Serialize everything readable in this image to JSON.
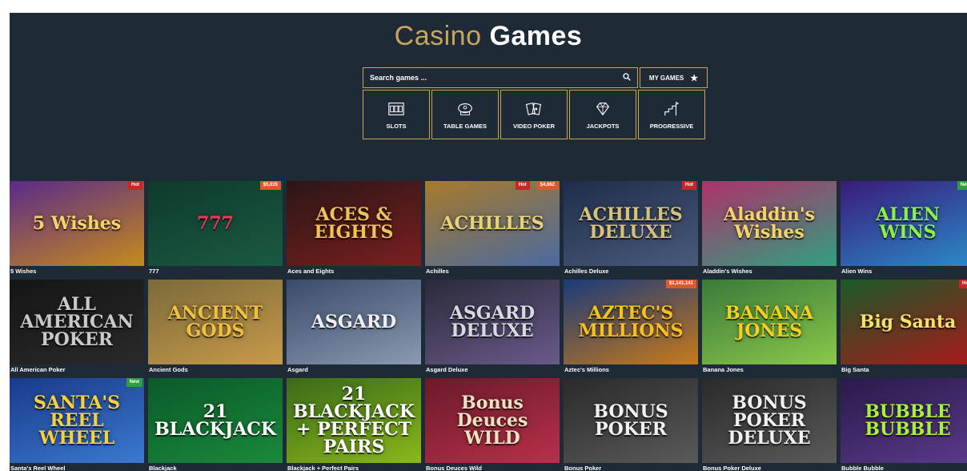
{
  "header": {
    "title_accent": "Casino",
    "title_main": "Games"
  },
  "search": {
    "placeholder": "Search games ..."
  },
  "my_games": {
    "label": "MY GAMES"
  },
  "categories": [
    {
      "label": "SLOTS",
      "icon": "slots-icon"
    },
    {
      "label": "TABLE GAMES",
      "icon": "table-games-icon"
    },
    {
      "label": "VIDEO POKER",
      "icon": "video-poker-icon"
    },
    {
      "label": "JACKPOTS",
      "icon": "diamond-icon"
    },
    {
      "label": "PROGRESSIVE",
      "icon": "progressive-icon"
    }
  ],
  "games": [
    {
      "name": "5 Wishes",
      "logo": "5 Wishes",
      "badges": [
        "Hot"
      ],
      "bg": "#5a2a8a",
      "bg2": "#c58a1c",
      "fg": "#f5d36b"
    },
    {
      "name": "777",
      "logo": "777",
      "badges": [
        "$5,035"
      ],
      "bg": "#0e3a2c",
      "bg2": "#1a5a42",
      "fg": "#e83b5a"
    },
    {
      "name": "Aces and Eights",
      "logo": "ACES & EIGHTS",
      "badges": [],
      "bg": "#2b1616",
      "bg2": "#7a1f1f",
      "fg": "#f0c35a"
    },
    {
      "name": "Achilles",
      "logo": "ACHILLES",
      "badges": [
        "Hot",
        "$4,862"
      ],
      "bg": "#a87a2a",
      "bg2": "#4a6aa0",
      "fg": "#e8d27a"
    },
    {
      "name": "Achilles Deluxe",
      "logo": "ACHILLES DELUXE",
      "badges": [
        "Hot"
      ],
      "bg": "#1e2d4a",
      "bg2": "#4a5a7a",
      "fg": "#d8c27a"
    },
    {
      "name": "Aladdin's Wishes",
      "logo": "Aladdin's Wishes",
      "badges": [],
      "bg": "#b0306a",
      "bg2": "#30a080",
      "fg": "#f5d36b"
    },
    {
      "name": "Alien Wins",
      "logo": "ALIEN WINS",
      "badges": [
        "New"
      ],
      "bg": "#3a1a7a",
      "bg2": "#2a8ac8",
      "fg": "#8af04a"
    },
    {
      "name": "All American Poker",
      "logo": "ALL AMERICAN POKER",
      "badges": [],
      "bg": "#151515",
      "bg2": "#2a2a2a",
      "fg": "#c9c9c9"
    },
    {
      "name": "Ancient Gods",
      "logo": "ANCIENT GODS",
      "badges": [],
      "bg": "#7a6a3a",
      "bg2": "#c89a4a",
      "fg": "#f0c040"
    },
    {
      "name": "Asgard",
      "logo": "ASGARD",
      "badges": [],
      "bg": "#3a4a6a",
      "bg2": "#8a9ab0",
      "fg": "#eef0f5"
    },
    {
      "name": "Asgard Deluxe",
      "logo": "ASGARD DELUXE",
      "badges": [],
      "bg": "#2a2a3a",
      "bg2": "#6a5a8a",
      "fg": "#d8d8e0"
    },
    {
      "name": "Aztec's Millions",
      "logo": "AZTEC'S MILLIONS",
      "badges": [
        "$1,141,141"
      ],
      "bg": "#1a3a7a",
      "bg2": "#c87a1a",
      "fg": "#f5c020"
    },
    {
      "name": "Banana Jones",
      "logo": "BANANA JONES",
      "badges": [],
      "bg": "#3a7a3a",
      "bg2": "#8ac84a",
      "fg": "#f5d020"
    },
    {
      "name": "Big Santa",
      "logo": "Big Santa",
      "badges": [
        "Hot"
      ],
      "bg": "#1a5a2a",
      "bg2": "#a81a1a",
      "fg": "#f5e06a"
    },
    {
      "name": "Santa's Reel Wheel",
      "logo": "SANTA'S REEL WHEEL",
      "badges": [
        "New"
      ],
      "bg": "#1a3a8a",
      "bg2": "#3a7ad0",
      "fg": "#f5d040"
    },
    {
      "name": "Blackjack",
      "logo": "21 BLACKJACK",
      "badges": [],
      "bg": "#0a5a2a",
      "bg2": "#1a8a3a",
      "fg": "#ffffff"
    },
    {
      "name": "Blackjack + Perfect Pairs",
      "logo": "21 BLACKJACK + PERFECT PAIRS",
      "badges": [],
      "bg": "#3a6a1a",
      "bg2": "#8ab81a",
      "fg": "#ffffff"
    },
    {
      "name": "Bonus Deuces Wild",
      "logo": "Bonus Deuces WILD",
      "badges": [],
      "bg": "#6a1a2a",
      "bg2": "#b8304a",
      "fg": "#f0e0c0"
    },
    {
      "name": "Bonus Poker",
      "logo": "BONUS POKER",
      "badges": [],
      "bg": "#2a2a2a",
      "bg2": "#5a5a5a",
      "fg": "#f0f0f0"
    },
    {
      "name": "Bonus Poker Deluxe",
      "logo": "BONUS POKER DELUXE",
      "badges": [],
      "bg": "#2a2a2a",
      "bg2": "#5a5a5a",
      "fg": "#f0f0f0"
    },
    {
      "name": "Bubble Bubble",
      "logo": "BUBBLE BUBBLE",
      "badges": [],
      "bg": "#2a1a4a",
      "bg2": "#5a3a8a",
      "fg": "#a8f040"
    }
  ]
}
